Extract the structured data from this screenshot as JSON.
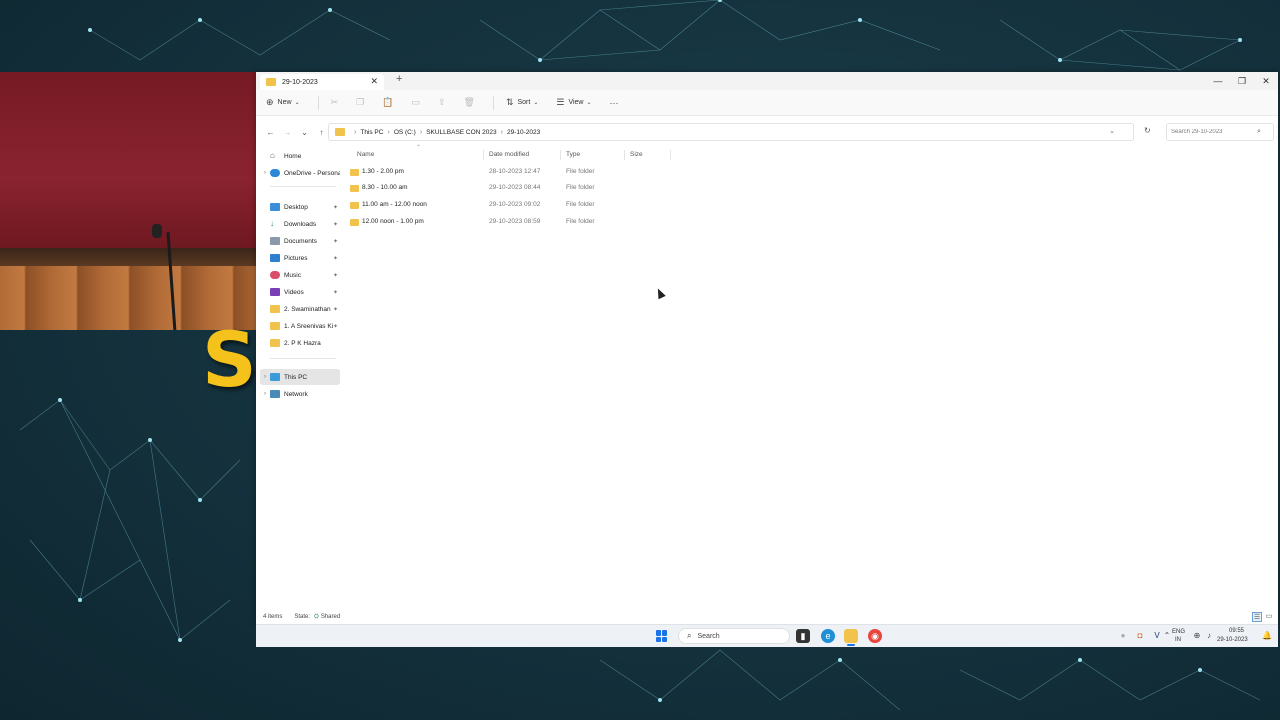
{
  "overlay": {
    "big_letter": "S"
  },
  "window": {
    "tab_title": "29-10-2023",
    "controls": {
      "minimize": "—",
      "maximize": "❐",
      "close": "✕"
    }
  },
  "command_bar": {
    "new_label": "New",
    "sort_label": "Sort",
    "view_label": "View",
    "more": "···"
  },
  "address": {
    "breadcrumbs": [
      "This PC",
      "OS (C:)",
      "SKULLBASE CON 2023",
      "29-10-2023"
    ],
    "search_placeholder": "Search 29-10-2023"
  },
  "nav_pane": {
    "items": [
      {
        "label": "Home",
        "icon": "home-icon"
      },
      {
        "label": "OneDrive - Persona",
        "icon": "cloud-icon"
      },
      {
        "label": "Desktop",
        "icon": "desktop-icon"
      },
      {
        "label": "Downloads",
        "icon": "download-icon"
      },
      {
        "label": "Documents",
        "icon": "document-icon"
      },
      {
        "label": "Pictures",
        "icon": "picture-icon"
      },
      {
        "label": "Music",
        "icon": "music-icon"
      },
      {
        "label": "Videos",
        "icon": "video-icon"
      },
      {
        "label": "2. Swaminathan",
        "icon": "folder-icon"
      },
      {
        "label": "1. A Sreenivas Ki",
        "icon": "folder-icon"
      },
      {
        "label": "2. P K Hazra",
        "icon": "folder-icon"
      },
      {
        "label": "This PC",
        "icon": "computer-icon"
      },
      {
        "label": "Network",
        "icon": "network-icon"
      }
    ]
  },
  "file_list": {
    "columns": [
      "Name",
      "Date modified",
      "Type",
      "Size"
    ],
    "rows": [
      {
        "name": "1.30 - 2.00 pm",
        "date": "28-10-2023 12:47",
        "type": "File folder"
      },
      {
        "name": "8.30 - 10.00 am",
        "date": "29-10-2023 08:44",
        "type": "File folder"
      },
      {
        "name": "11.00 am - 12.00 noon",
        "date": "29-10-2023 09:02",
        "type": "File folder"
      },
      {
        "name": "12.00 noon - 1.00 pm",
        "date": "29-10-2023 08:59",
        "type": "File folder"
      }
    ]
  },
  "status_bar": {
    "item_count": "4 items",
    "state_label": "State:",
    "state_value": "Shared"
  },
  "taskbar": {
    "search_label": "Search",
    "lang_top": "ENG",
    "lang_bottom": "IN",
    "time": "09:55",
    "date": "29-10-2023"
  },
  "colors": {
    "folder": "#f2c34c",
    "accent": "#1a73e8",
    "overlay_letter": "#f4c21b"
  }
}
